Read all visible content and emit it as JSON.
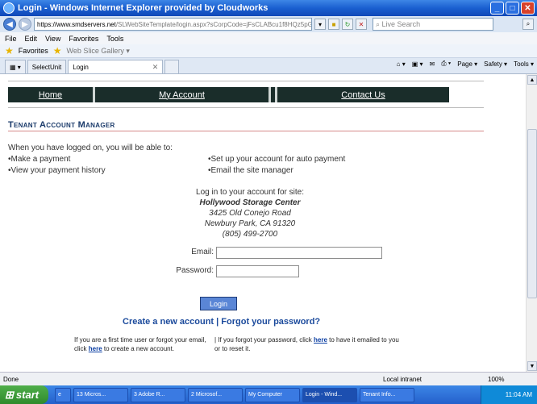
{
  "window": {
    "title": "Login - Windows Internet Explorer provided by Cloudworks"
  },
  "address": {
    "url_host": "https://www.smdservers.net",
    "url_path": "/SLWebSiteTemplate/login.aspx?sCorpCode=jFsCLABcu1f8HQz5pGUAN==",
    "search_placeholder": "Live Search"
  },
  "menu": [
    "File",
    "Edit",
    "View",
    "Favorites",
    "Tools"
  ],
  "favorites": {
    "label": "Favorites",
    "web_slice": "Web Slice Gallery ▾"
  },
  "tabs": [
    {
      "label": "SelectUnit"
    },
    {
      "label": "Login"
    }
  ],
  "commands": [
    "Page ▾",
    "Safety ▾",
    "Tools ▾"
  ],
  "site_nav": [
    "Home",
    "My Account",
    "Contact Us"
  ],
  "page": {
    "heading": "Tenant Account Manager",
    "intro": "When you have logged on,  you will be able to:",
    "bullets_left": [
      "•Make a payment",
      "•View your payment history"
    ],
    "bullets_right": [
      "•Set up your account for auto payment",
      "•Email the site manager"
    ],
    "login_prompt": "Log in to your account for site:",
    "site_name": "Hollywood Storage Center",
    "address1": "3425 Old Conejo Road",
    "address2": "Newbury Park, CA 91320",
    "phone": "(805) 499-2700",
    "email_label": "Email:",
    "password_label": "Password:",
    "login_button": "Login",
    "create_account_link": "Create a new account",
    "link_separator": " | ",
    "forgot_password_link": "Forgot your password?",
    "note_left_1": "If you are a first time user or forgot your email,",
    "note_left_2a": "click ",
    "note_left_here": "here",
    "note_left_2b": " to create a new account.",
    "note_right_1a": "| If you forgot your password, click ",
    "note_right_here": "here",
    "note_right_1b": " to have it emailed to you",
    "note_right_2": "or to reset it."
  },
  "status": {
    "text": "Done",
    "zone": "Local intranet",
    "zoom": "100%"
  },
  "taskbar": {
    "start": "start",
    "tasks": [
      "13 Micros...",
      "3 Adobe R...",
      "2 Microsof...",
      "My Computer",
      "Login - Wind...",
      "Tenant Info..."
    ],
    "time": "11:04 AM"
  }
}
